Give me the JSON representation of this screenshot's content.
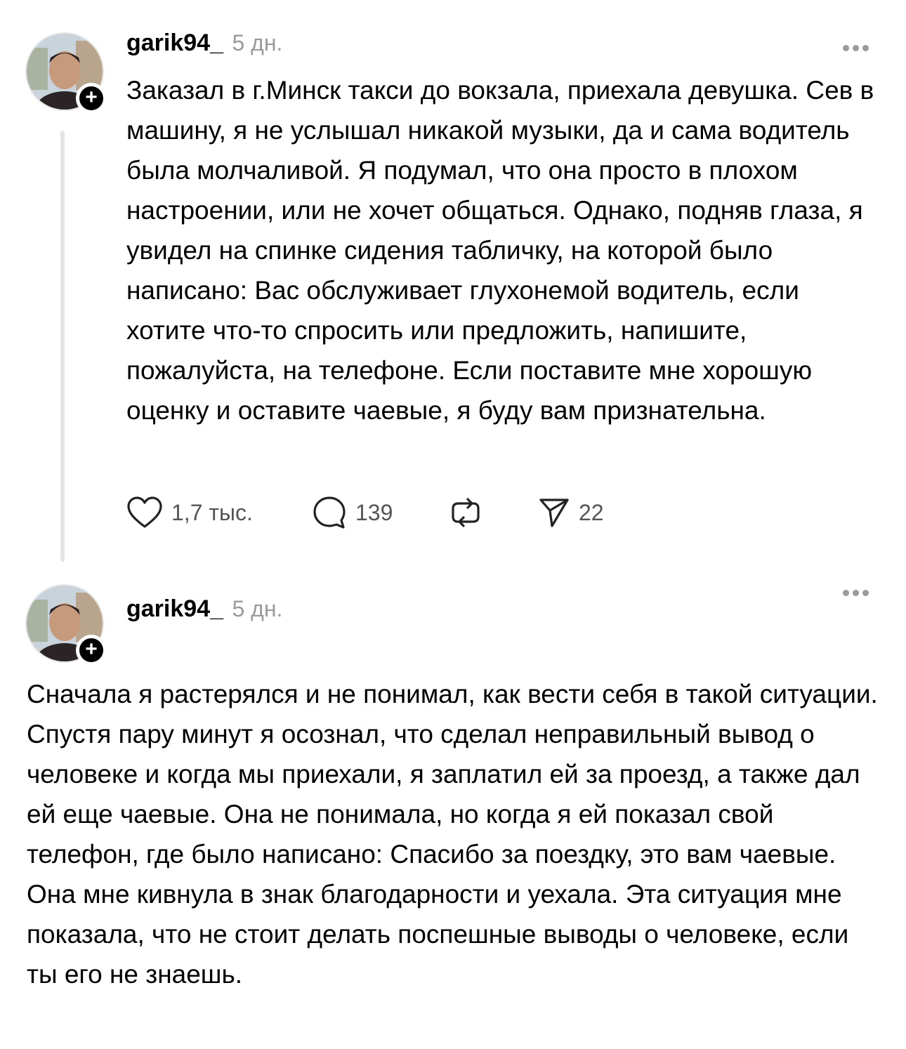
{
  "posts": [
    {
      "username": "garik94_",
      "time": "5 дн.",
      "follow_symbol": "+",
      "text": "Заказал в г.Минск такси до вокзала, приехала девушка. Сев в машину, я не услышал никакой музыки, да и сама водитель была молчаливой. Я подумал, что она просто в плохом настроении, или не хочет общаться. Однако, подняв глаза, я увидел на спинке сидения табличку, на которой было написано: Вас обслуживает глухонемой водитель, если хотите что-то спросить или предложить, напишите, пожалуйста, на телефоне. Если поставите мне хорошую оценку и оставите чаевые, я буду вам признательна.",
      "actions": {
        "likes": "1,7 тыс.",
        "comments": "139",
        "shares": "22"
      },
      "icons": [
        "heart-icon",
        "comment-icon",
        "repost-icon",
        "send-icon",
        "more-icon"
      ]
    },
    {
      "username": "garik94_",
      "time": "5 дн.",
      "follow_symbol": "+",
      "text": "Сначала я растерялся и не понимал, как вести себя в такой ситуации. Спустя пару минут я осознал, что сделал неправильный вывод о человеке и когда мы приехали, я заплатил ей за проезд, а также дал ей еще чаевые. Она не понимала, но когда я ей показал свой телефон, где было написано: Спасибо за поездку, это вам чаевые. Она мне кивнула в знак благодарности и уехала. Эта ситуация мне показала, что не стоит делать поспешные выводы о человеке, если ты его не знаешь.",
      "icons": [
        "more-icon"
      ]
    }
  ],
  "colors": {
    "text": "#000000",
    "muted": "#9a9a9a",
    "thread_line": "#e4e4e4",
    "badge": "#000000"
  }
}
